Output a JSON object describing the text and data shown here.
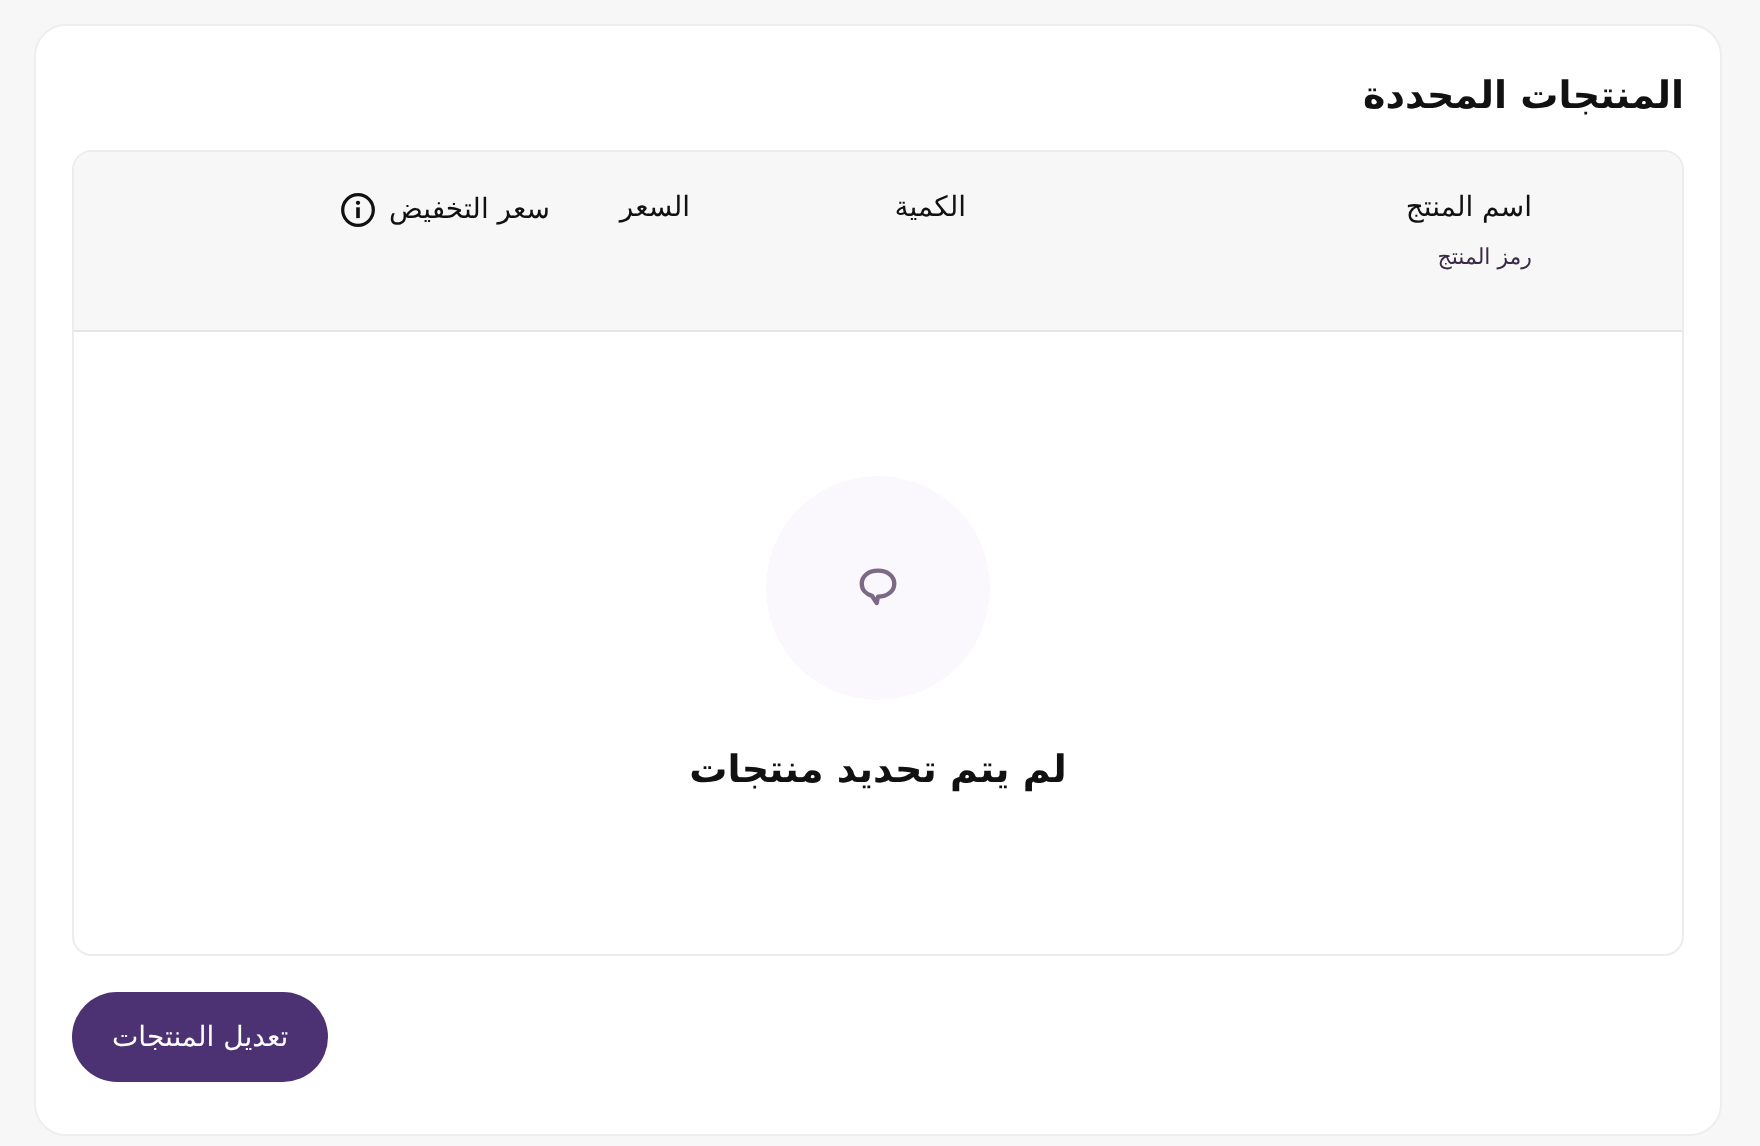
{
  "title": "المنتجات المحددة",
  "table": {
    "columns": [
      {
        "label": "اسم المنتج",
        "sublabel": "رمز المنتج"
      },
      {
        "label": "الكمية"
      },
      {
        "label": "السعر"
      },
      {
        "label": "سعر التخفيض",
        "info": true
      }
    ]
  },
  "empty_state": {
    "message": "لم يتم تحديد منتجات"
  },
  "buttons": [
    "تعديل المنتجات"
  ]
}
